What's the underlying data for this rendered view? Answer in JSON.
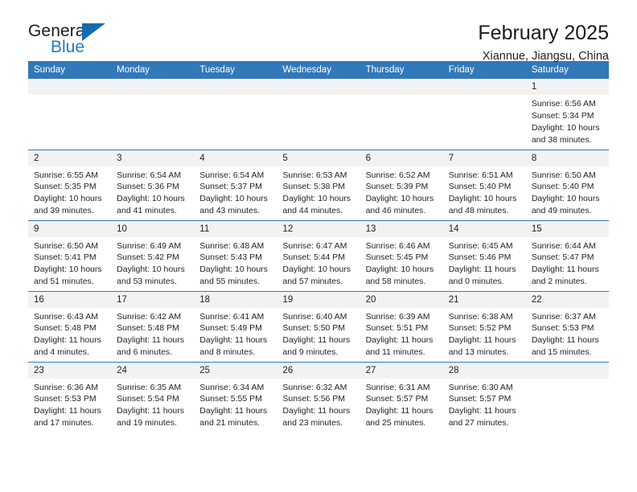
{
  "logo": {
    "word_general": "General",
    "word_blue": "Blue",
    "triangle_color": "#176BB0",
    "blue_text_color": "#1F7AC0"
  },
  "header": {
    "title": "February 2025",
    "subtitle": "Xiannue, Jiangsu, China"
  },
  "theme": {
    "header_bg": "#3179B9",
    "header_text": "#FFFFFF",
    "daynum_bg": "#F2F2F2",
    "row_rule": "#3179B9",
    "body_text": "#231F20"
  },
  "weekday_headers": [
    "Sunday",
    "Monday",
    "Tuesday",
    "Wednesday",
    "Thursday",
    "Friday",
    "Saturday"
  ],
  "weeks": [
    [
      {
        "day": "",
        "sunrise": "",
        "sunset": "",
        "daylight": "",
        "daylight2": ""
      },
      {
        "day": "",
        "sunrise": "",
        "sunset": "",
        "daylight": "",
        "daylight2": ""
      },
      {
        "day": "",
        "sunrise": "",
        "sunset": "",
        "daylight": "",
        "daylight2": ""
      },
      {
        "day": "",
        "sunrise": "",
        "sunset": "",
        "daylight": "",
        "daylight2": ""
      },
      {
        "day": "",
        "sunrise": "",
        "sunset": "",
        "daylight": "",
        "daylight2": ""
      },
      {
        "day": "",
        "sunrise": "",
        "sunset": "",
        "daylight": "",
        "daylight2": ""
      },
      {
        "day": "1",
        "sunrise": "Sunrise: 6:56 AM",
        "sunset": "Sunset: 5:34 PM",
        "daylight": "Daylight: 10 hours",
        "daylight2": "and 38 minutes."
      }
    ],
    [
      {
        "day": "2",
        "sunrise": "Sunrise: 6:55 AM",
        "sunset": "Sunset: 5:35 PM",
        "daylight": "Daylight: 10 hours",
        "daylight2": "and 39 minutes."
      },
      {
        "day": "3",
        "sunrise": "Sunrise: 6:54 AM",
        "sunset": "Sunset: 5:36 PM",
        "daylight": "Daylight: 10 hours",
        "daylight2": "and 41 minutes."
      },
      {
        "day": "4",
        "sunrise": "Sunrise: 6:54 AM",
        "sunset": "Sunset: 5:37 PM",
        "daylight": "Daylight: 10 hours",
        "daylight2": "and 43 minutes."
      },
      {
        "day": "5",
        "sunrise": "Sunrise: 6:53 AM",
        "sunset": "Sunset: 5:38 PM",
        "daylight": "Daylight: 10 hours",
        "daylight2": "and 44 minutes."
      },
      {
        "day": "6",
        "sunrise": "Sunrise: 6:52 AM",
        "sunset": "Sunset: 5:39 PM",
        "daylight": "Daylight: 10 hours",
        "daylight2": "and 46 minutes."
      },
      {
        "day": "7",
        "sunrise": "Sunrise: 6:51 AM",
        "sunset": "Sunset: 5:40 PM",
        "daylight": "Daylight: 10 hours",
        "daylight2": "and 48 minutes."
      },
      {
        "day": "8",
        "sunrise": "Sunrise: 6:50 AM",
        "sunset": "Sunset: 5:40 PM",
        "daylight": "Daylight: 10 hours",
        "daylight2": "and 49 minutes."
      }
    ],
    [
      {
        "day": "9",
        "sunrise": "Sunrise: 6:50 AM",
        "sunset": "Sunset: 5:41 PM",
        "daylight": "Daylight: 10 hours",
        "daylight2": "and 51 minutes."
      },
      {
        "day": "10",
        "sunrise": "Sunrise: 6:49 AM",
        "sunset": "Sunset: 5:42 PM",
        "daylight": "Daylight: 10 hours",
        "daylight2": "and 53 minutes."
      },
      {
        "day": "11",
        "sunrise": "Sunrise: 6:48 AM",
        "sunset": "Sunset: 5:43 PM",
        "daylight": "Daylight: 10 hours",
        "daylight2": "and 55 minutes."
      },
      {
        "day": "12",
        "sunrise": "Sunrise: 6:47 AM",
        "sunset": "Sunset: 5:44 PM",
        "daylight": "Daylight: 10 hours",
        "daylight2": "and 57 minutes."
      },
      {
        "day": "13",
        "sunrise": "Sunrise: 6:46 AM",
        "sunset": "Sunset: 5:45 PM",
        "daylight": "Daylight: 10 hours",
        "daylight2": "and 58 minutes."
      },
      {
        "day": "14",
        "sunrise": "Sunrise: 6:45 AM",
        "sunset": "Sunset: 5:46 PM",
        "daylight": "Daylight: 11 hours",
        "daylight2": "and 0 minutes."
      },
      {
        "day": "15",
        "sunrise": "Sunrise: 6:44 AM",
        "sunset": "Sunset: 5:47 PM",
        "daylight": "Daylight: 11 hours",
        "daylight2": "and 2 minutes."
      }
    ],
    [
      {
        "day": "16",
        "sunrise": "Sunrise: 6:43 AM",
        "sunset": "Sunset: 5:48 PM",
        "daylight": "Daylight: 11 hours",
        "daylight2": "and 4 minutes."
      },
      {
        "day": "17",
        "sunrise": "Sunrise: 6:42 AM",
        "sunset": "Sunset: 5:48 PM",
        "daylight": "Daylight: 11 hours",
        "daylight2": "and 6 minutes."
      },
      {
        "day": "18",
        "sunrise": "Sunrise: 6:41 AM",
        "sunset": "Sunset: 5:49 PM",
        "daylight": "Daylight: 11 hours",
        "daylight2": "and 8 minutes."
      },
      {
        "day": "19",
        "sunrise": "Sunrise: 6:40 AM",
        "sunset": "Sunset: 5:50 PM",
        "daylight": "Daylight: 11 hours",
        "daylight2": "and 9 minutes."
      },
      {
        "day": "20",
        "sunrise": "Sunrise: 6:39 AM",
        "sunset": "Sunset: 5:51 PM",
        "daylight": "Daylight: 11 hours",
        "daylight2": "and 11 minutes."
      },
      {
        "day": "21",
        "sunrise": "Sunrise: 6:38 AM",
        "sunset": "Sunset: 5:52 PM",
        "daylight": "Daylight: 11 hours",
        "daylight2": "and 13 minutes."
      },
      {
        "day": "22",
        "sunrise": "Sunrise: 6:37 AM",
        "sunset": "Sunset: 5:53 PM",
        "daylight": "Daylight: 11 hours",
        "daylight2": "and 15 minutes."
      }
    ],
    [
      {
        "day": "23",
        "sunrise": "Sunrise: 6:36 AM",
        "sunset": "Sunset: 5:53 PM",
        "daylight": "Daylight: 11 hours",
        "daylight2": "and 17 minutes."
      },
      {
        "day": "24",
        "sunrise": "Sunrise: 6:35 AM",
        "sunset": "Sunset: 5:54 PM",
        "daylight": "Daylight: 11 hours",
        "daylight2": "and 19 minutes."
      },
      {
        "day": "25",
        "sunrise": "Sunrise: 6:34 AM",
        "sunset": "Sunset: 5:55 PM",
        "daylight": "Daylight: 11 hours",
        "daylight2": "and 21 minutes."
      },
      {
        "day": "26",
        "sunrise": "Sunrise: 6:32 AM",
        "sunset": "Sunset: 5:56 PM",
        "daylight": "Daylight: 11 hours",
        "daylight2": "and 23 minutes."
      },
      {
        "day": "27",
        "sunrise": "Sunrise: 6:31 AM",
        "sunset": "Sunset: 5:57 PM",
        "daylight": "Daylight: 11 hours",
        "daylight2": "and 25 minutes."
      },
      {
        "day": "28",
        "sunrise": "Sunrise: 6:30 AM",
        "sunset": "Sunset: 5:57 PM",
        "daylight": "Daylight: 11 hours",
        "daylight2": "and 27 minutes."
      },
      {
        "day": "",
        "sunrise": "",
        "sunset": "",
        "daylight": "",
        "daylight2": ""
      }
    ]
  ]
}
